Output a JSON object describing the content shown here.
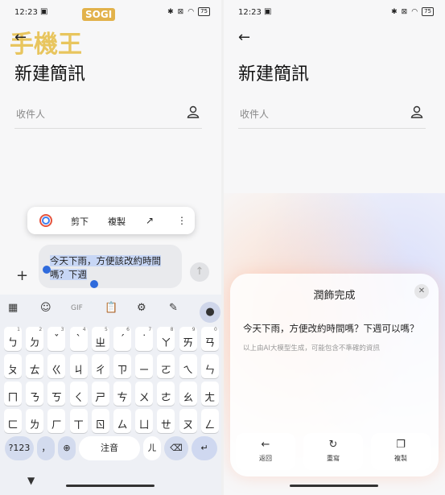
{
  "left": {
    "status": {
      "time": "12:23",
      "battery": "75"
    },
    "watermark": "SOGI",
    "watermark_script": "手機王",
    "title": "新建簡訊",
    "recipient_placeholder": "收件人",
    "popup": {
      "cut": "剪下",
      "copy": "複製"
    },
    "message": {
      "line1": "今天下雨，方便該改約時間",
      "line2": "嗎？下週"
    },
    "keyboard": {
      "toolbar_gif": "GIF",
      "row1": [
        [
          "ㄅ",
          "1"
        ],
        [
          "ㄉ",
          "2"
        ],
        [
          "ˇ",
          "3"
        ],
        [
          "ˋ",
          "4"
        ],
        [
          "ㄓ",
          "5"
        ],
        [
          "ˊ",
          "6"
        ],
        [
          "˙",
          "7"
        ],
        [
          "ㄚ",
          "8"
        ],
        [
          "ㄞ",
          "9"
        ],
        [
          "ㄢ",
          "0"
        ]
      ],
      "row2": [
        "ㄆ",
        "ㄊ",
        "ㄍ",
        "ㄐ",
        "ㄔ",
        "ㄗ",
        "ㄧ",
        "ㄛ",
        "ㄟ",
        "ㄣ"
      ],
      "row3": [
        "ㄇ",
        "ㄋ",
        "ㄎ",
        "ㄑ",
        "ㄕ",
        "ㄘ",
        "ㄨ",
        "ㄜ",
        "ㄠ",
        "ㄤ"
      ],
      "row4": [
        "ㄈ",
        "ㄌ",
        "ㄏ",
        "ㄒ",
        "ㄖ",
        "ㄙ",
        "ㄩ",
        "ㄝ",
        "ㄡ",
        "ㄥ"
      ],
      "sym": "?123",
      "comma": "，",
      "space": "注音",
      "er": "ㄦ"
    }
  },
  "right": {
    "status": {
      "time": "12:23",
      "battery": "75"
    },
    "title": "新建簡訊",
    "recipient_placeholder": "收件人",
    "sheet": {
      "title": "潤飾完成",
      "result": "今天下雨，方便改約時間嗎？下週可以嗎？",
      "note": "以上由AI大模型生成，可能包含不準確的資訊",
      "actions": {
        "back": "返回",
        "rewrite": "重寫",
        "copy": "複製"
      }
    }
  }
}
